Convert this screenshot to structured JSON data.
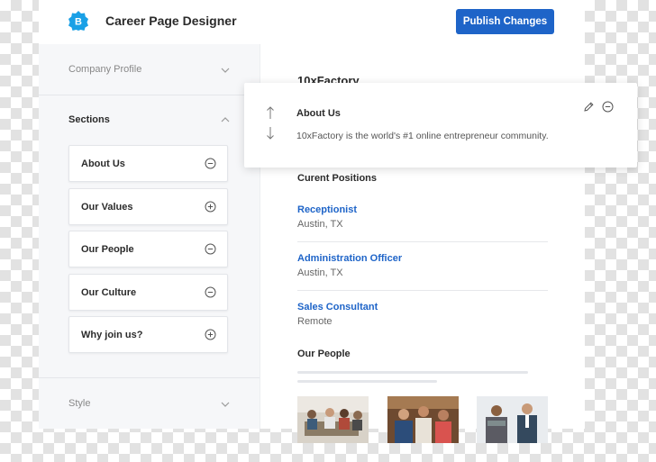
{
  "header": {
    "logo_letter": "B",
    "title": "Career Page Designer",
    "publish_label": "Publish Changes"
  },
  "sidebar": {
    "company_profile": "Company Profile",
    "sections_heading": "Sections",
    "sections": [
      {
        "label": "About Us",
        "action": "minus-circle-icon"
      },
      {
        "label": "Our Values",
        "action": "plus-circle-icon"
      },
      {
        "label": "Our People",
        "action": "minus-circle-icon"
      },
      {
        "label": "Our Culture",
        "action": "minus-circle-icon"
      },
      {
        "label": "Why join us?",
        "action": "plus-circle-icon"
      }
    ],
    "style": "Style"
  },
  "preview": {
    "company": "10xFactory",
    "positions_heading": "Curent Positions",
    "positions": [
      {
        "title": "Receptionist",
        "location": "Austin, TX"
      },
      {
        "title": "Administration Officer",
        "location": "Austin, TX"
      },
      {
        "title": "Sales Consultant",
        "location": "Remote"
      }
    ],
    "people_heading": "Our People"
  },
  "popup": {
    "title": "About Us",
    "text": "10xFactory is the world's #1 online entrepreneur community."
  },
  "colors": {
    "accent": "#1e64c8",
    "sidebar_bg": "#f6f7f9"
  }
}
